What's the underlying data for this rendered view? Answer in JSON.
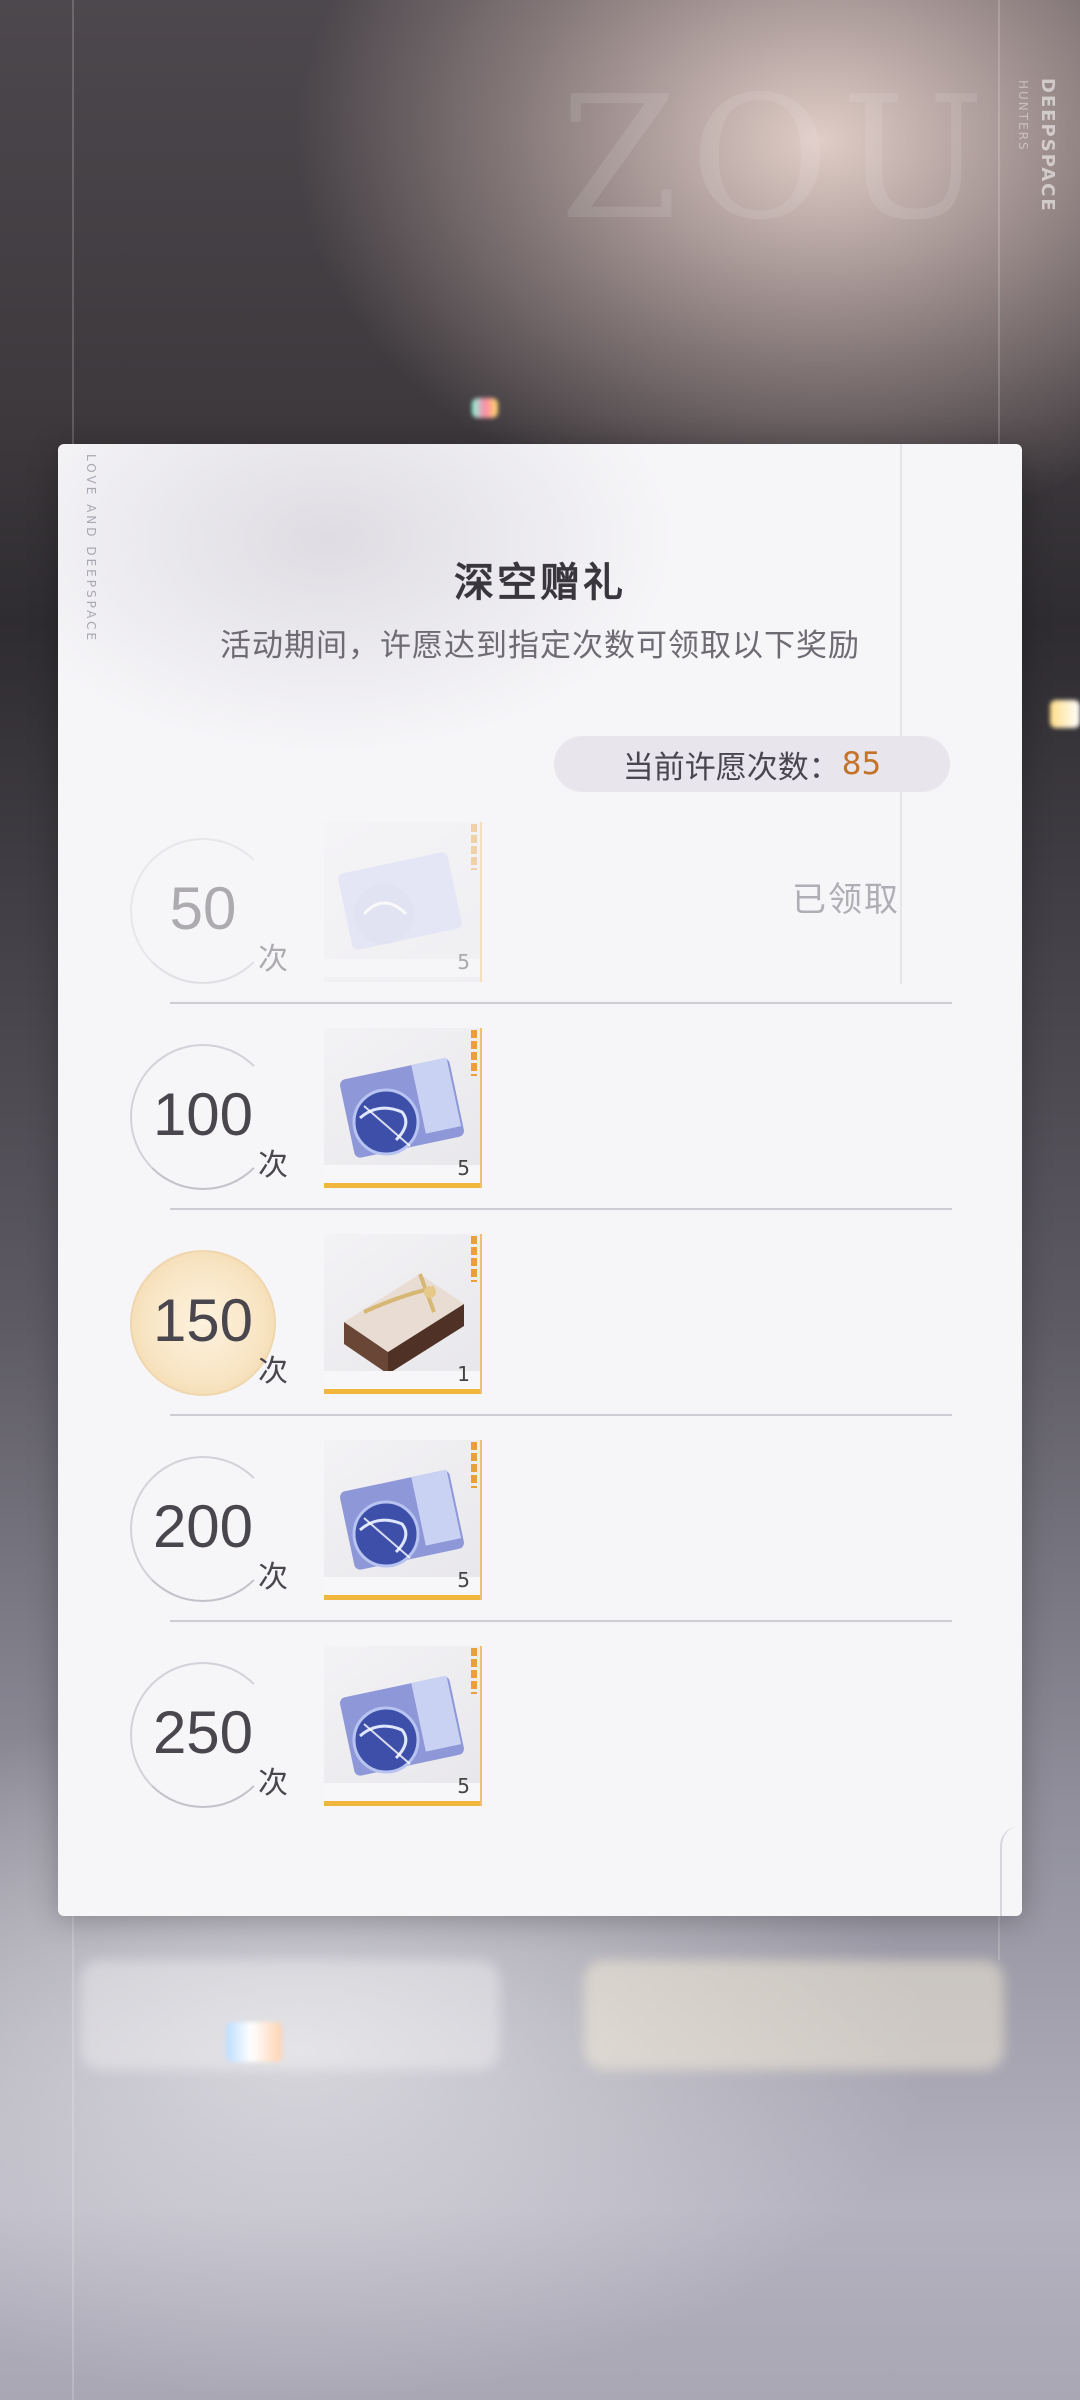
{
  "background": {
    "watermark": "ZOU",
    "brand": "DEEPSPACE",
    "brand_sub": "HUNTERS",
    "panel_vertical_text": "LOVE AND DEEPSPACE"
  },
  "panel": {
    "title": "深空赠礼",
    "subtitle": "活动期间，许愿达到指定次数可领取以下奖励",
    "wish_count_label": "当前许愿次数：",
    "wish_count_value": "85",
    "unit": "次",
    "claimed_label": "已领取",
    "milestones": [
      {
        "threshold": "50",
        "quantity": "5",
        "item_icon": "ticket-globe-icon",
        "status": "claimed"
      },
      {
        "threshold": "100",
        "quantity": "5",
        "item_icon": "ticket-globe-icon",
        "status": "locked"
      },
      {
        "threshold": "150",
        "quantity": "1",
        "item_icon": "gift-box-icon",
        "status": "highlight"
      },
      {
        "threshold": "200",
        "quantity": "5",
        "item_icon": "ticket-globe-icon",
        "status": "locked"
      },
      {
        "threshold": "250",
        "quantity": "5",
        "item_icon": "ticket-globe-icon",
        "status": "locked"
      }
    ]
  },
  "colors": {
    "accent_orange": "#c4732a",
    "rarity_gold": "#f1b73c",
    "panel_bg": "#f6f5f8"
  }
}
